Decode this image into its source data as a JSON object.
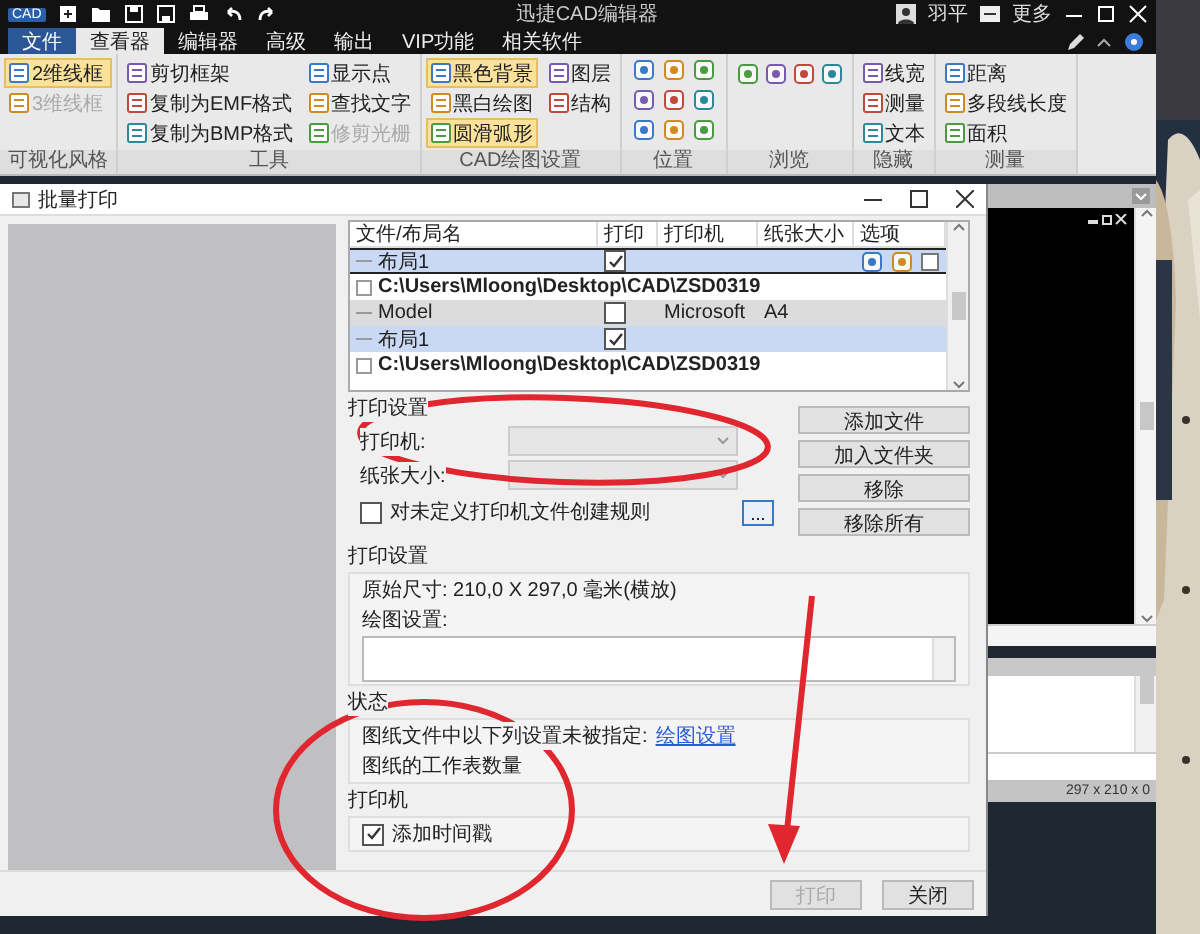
{
  "title_bar": {
    "app_badge": "CAD",
    "title": "迅捷CAD编辑器",
    "user": "羽平",
    "more": "更多"
  },
  "menu_tabs": [
    {
      "label": "文件",
      "kind": "file",
      "selected": false
    },
    {
      "label": "查看器",
      "kind": "tab",
      "selected": true
    },
    {
      "label": "编辑器",
      "kind": "tab",
      "selected": false
    },
    {
      "label": "高级",
      "kind": "tab",
      "selected": false
    },
    {
      "label": "输出",
      "kind": "tab",
      "selected": false
    },
    {
      "label": "VIP功能",
      "kind": "tab",
      "selected": false
    },
    {
      "label": "相关软件",
      "kind": "tab",
      "selected": false
    }
  ],
  "ribbon": {
    "groups": [
      {
        "title": "可视化风格",
        "kind": "labeled",
        "items": [
          {
            "label": "2维线框",
            "highlighted": true,
            "disabled": false
          },
          {
            "label": "3维线框",
            "highlighted": false,
            "disabled": true
          }
        ]
      },
      {
        "title": "工具",
        "kind": "labeled",
        "items": [
          {
            "label": "剪切框架",
            "highlighted": false,
            "disabled": false
          },
          {
            "label": "复制为EMF格式",
            "highlighted": false,
            "disabled": false
          },
          {
            "label": "复制为BMP格式",
            "highlighted": false,
            "disabled": false
          },
          {
            "label": "显示点",
            "highlighted": false,
            "disabled": false
          },
          {
            "label": "查找文字",
            "highlighted": false,
            "disabled": false
          },
          {
            "label": "修剪光栅",
            "highlighted": false,
            "disabled": true
          }
        ]
      },
      {
        "title": "CAD绘图设置",
        "kind": "labeled",
        "items": [
          {
            "label": "黑色背景",
            "highlighted": true,
            "disabled": false
          },
          {
            "label": "黑白绘图",
            "highlighted": false,
            "disabled": false
          },
          {
            "label": "圆滑弧形",
            "highlighted": true,
            "disabled": false
          },
          {
            "label": "图层",
            "highlighted": false,
            "disabled": false
          },
          {
            "label": "结构",
            "highlighted": false,
            "disabled": false
          }
        ]
      },
      {
        "title": "位置",
        "kind": "icon-grid"
      },
      {
        "title": "浏览",
        "kind": "icon-row"
      },
      {
        "title": "隐藏",
        "kind": "labeled",
        "items": [
          {
            "label": "线宽",
            "highlighted": false,
            "disabled": false
          },
          {
            "label": "测量",
            "highlighted": false,
            "disabled": false
          },
          {
            "label": "文本",
            "highlighted": false,
            "disabled": false
          }
        ]
      },
      {
        "title": "测量",
        "kind": "labeled",
        "items": [
          {
            "label": "距离",
            "highlighted": false,
            "disabled": false
          },
          {
            "label": "多段线长度",
            "highlighted": false,
            "disabled": false
          },
          {
            "label": "面积",
            "highlighted": false,
            "disabled": false
          }
        ]
      }
    ]
  },
  "dialog": {
    "title": "批量打印",
    "table": {
      "columns": [
        "文件/布局名",
        "打印",
        "打印机",
        "纸张大小",
        "选项"
      ],
      "rows": [
        {
          "kind": "layout",
          "name": "布局1",
          "print": true,
          "selected": true,
          "focused": true,
          "shaded": false,
          "options": true
        },
        {
          "kind": "folder",
          "name": "C:\\Users\\Mloong\\Desktop\\CAD\\ZSD0319"
        },
        {
          "kind": "layout",
          "name": "Model",
          "print": false,
          "printer": "Microsoft",
          "paper": "A4",
          "selected": false,
          "focused": false,
          "shaded": true,
          "options": false
        },
        {
          "kind": "layout",
          "name": "布局1",
          "print": true,
          "selected": true,
          "focused": false,
          "shaded": false,
          "options": false
        },
        {
          "kind": "folder",
          "name": "C:\\Users\\Mloong\\Desktop\\CAD\\ZSD0319"
        }
      ]
    },
    "printer_settings": {
      "title": "打印设置",
      "printer_label": "打印机:",
      "paper_label": "纸张大小:",
      "dropdowns_disabled": true,
      "rule_checkbox": {
        "label": "对未定义打印机文件创建规则",
        "checked": false
      },
      "browse_button": "..."
    },
    "file_buttons": [
      "添加文件",
      "加入文件夹",
      "移除",
      "移除所有"
    ],
    "print_setup": {
      "title": "打印设置",
      "original_size": "原始尺寸: 210,0 X 297,0 毫米(横放)",
      "plot_settings_label": "绘图设置:"
    },
    "status": {
      "title": "状态",
      "message": "图纸文件中以下列设置未被指定:",
      "link": "绘图设置",
      "sheet_count": "图纸的工作表数量"
    },
    "printer": {
      "title": "打印机",
      "timestamp": {
        "label": "添加时间戳",
        "checked": true
      }
    },
    "footer_buttons": [
      {
        "label": "打印",
        "disabled": true
      },
      {
        "label": "关闭",
        "disabled": false
      }
    ]
  },
  "cad_view": {
    "status": "297 x 210 x 0"
  }
}
